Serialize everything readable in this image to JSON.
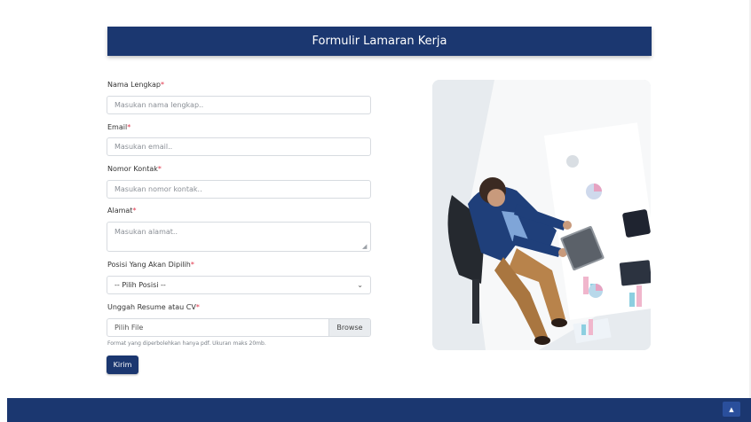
{
  "header": {
    "title": "Formulir Lamaran Kerja"
  },
  "form": {
    "name": {
      "label": "Nama Lengkap",
      "required_mark": "*",
      "placeholder": "Masukan nama lengkap.."
    },
    "email": {
      "label": "Email",
      "required_mark": "*",
      "placeholder": "Masukan email.."
    },
    "phone": {
      "label": "Nomor Kontak",
      "required_mark": "*",
      "placeholder": "Masukan nomor kontak.."
    },
    "address": {
      "label": "Alamat",
      "required_mark": "*",
      "placeholder": "Masukan alamat.."
    },
    "position": {
      "label": "Posisi Yang Akan Dipilih",
      "required_mark": "*",
      "selected": "-- Pilih Posisi --"
    },
    "resume": {
      "label": "Unggah Resume atau CV",
      "required_mark": "*",
      "file_text": "Pilih File",
      "browse_label": "Browse",
      "hint": "Format yang diperbolehkan hanya pdf. Ukuran maks 20mb."
    },
    "submit_label": "Kirim"
  },
  "colors": {
    "primary": "#1b3770",
    "required": "#e0344a"
  },
  "icons": {
    "select_arrow": "chevron-down-icon",
    "back_to_top": "chevron-up-icon"
  }
}
